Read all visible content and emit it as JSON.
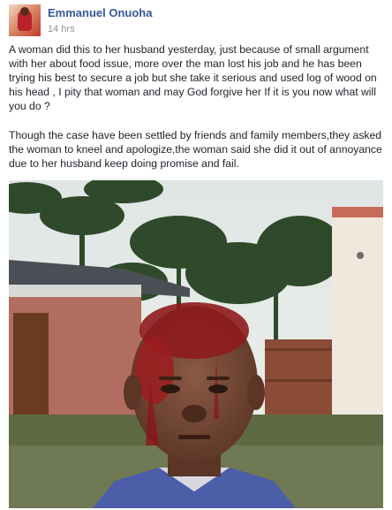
{
  "post": {
    "author": "Emmanuel Onuoha",
    "timestamp": "14 hrs",
    "paragraphs": [
      "A woman did this to her husband yesterday, just because of small argument with her about food issue, more over the man lost his job and he has been trying his best to secure a job but she take it serious and used log of wood on his head , I pity that woman and may God forgive her If it is you now what will you do ?",
      "Though the case have been settled by friends and family members,they asked the woman to kneel and apologize,the woman said she did it out of annoyance due to her husband keep doing promise and fail."
    ]
  },
  "colors": {
    "author_link": "#365899",
    "body_text": "#1d2129",
    "meta_text": "#90949c"
  },
  "icons": {
    "avatar": "profile-photo",
    "photo": "post-photo"
  }
}
